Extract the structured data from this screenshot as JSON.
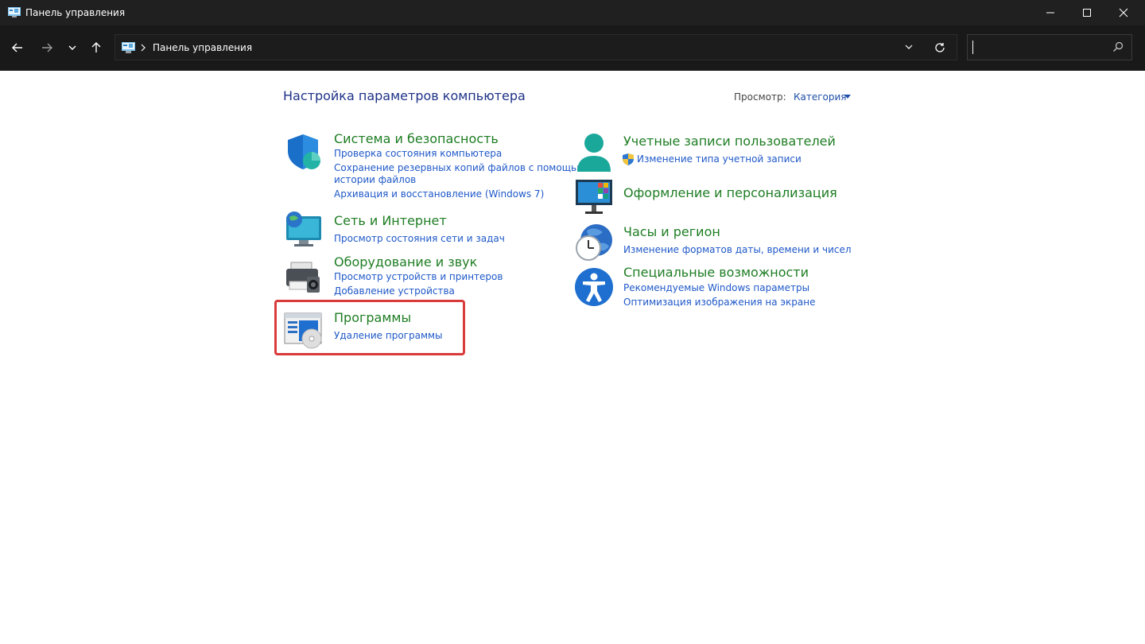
{
  "window": {
    "title": "Панель управления"
  },
  "address": {
    "path": "Панель управления"
  },
  "search": {
    "value": ""
  },
  "page": {
    "title": "Настройка параметров компьютера",
    "view_label": "Просмотр:",
    "view_value": "Категория"
  },
  "categories_left": [
    {
      "title": "Система и безопасность",
      "links": [
        "Проверка состояния компьютера",
        "Сохранение резервных копий файлов с помощью",
        "истории файлов",
        "Архивация и восстановление (Windows 7)"
      ],
      "icon": "shield-icon"
    },
    {
      "title": "Сеть и Интернет",
      "links": [
        "Просмотр состояния сети и задач"
      ],
      "icon": "network-globe-icon"
    },
    {
      "title": "Оборудование и звук",
      "links": [
        "Просмотр устройств и принтеров",
        "Добавление устройства"
      ],
      "icon": "printer-icon"
    },
    {
      "title": "Программы",
      "links": [
        "Удаление программы"
      ],
      "icon": "programs-disc-icon"
    }
  ],
  "categories_right": [
    {
      "title": "Учетные записи пользователей",
      "links": [
        "Изменение типа учетной записи"
      ],
      "icon": "user-icon"
    },
    {
      "title": "Оформление и персонализация",
      "links": [],
      "icon": "monitor-personalization-icon"
    },
    {
      "title": "Часы и регион",
      "links": [
        "Изменение форматов даты, времени и чисел"
      ],
      "icon": "clock-globe-icon"
    },
    {
      "title": "Специальные возможности",
      "links": [
        "Рекомендуемые Windows параметры",
        "Оптимизация изображения на экране"
      ],
      "icon": "accessibility-icon"
    }
  ],
  "colors": {
    "title_green": "#1e7d23",
    "link_blue": "#1e58c8",
    "header_blue": "#1e3287",
    "highlight_red": "#d93a3a",
    "chrome_dark": "#202020"
  }
}
